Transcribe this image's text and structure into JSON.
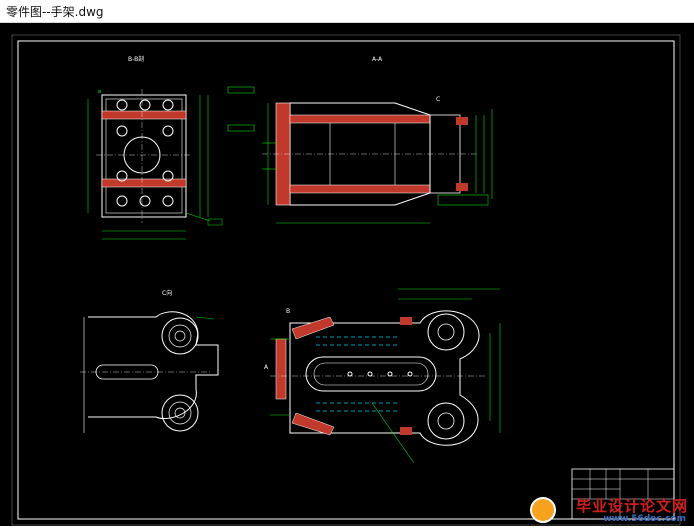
{
  "window": {
    "title": "零件图--手架.dwg"
  },
  "drawing": {
    "labels": {
      "section_bb": "B-B剖",
      "section_aa": "A-A",
      "view_c": "C向",
      "mark_c": "C",
      "mark_a": "A",
      "mark_b": "B"
    }
  },
  "watermark": {
    "brand": "毕业设计论文网",
    "url": "www.56doc.com"
  },
  "colors": {
    "canvas": "#000000",
    "line_white": "#ffffff",
    "line_green": "#00e000",
    "line_yellow": "#e8e800",
    "hatch_red": "#c0392b",
    "dim_cyan": "#00c8ff"
  }
}
